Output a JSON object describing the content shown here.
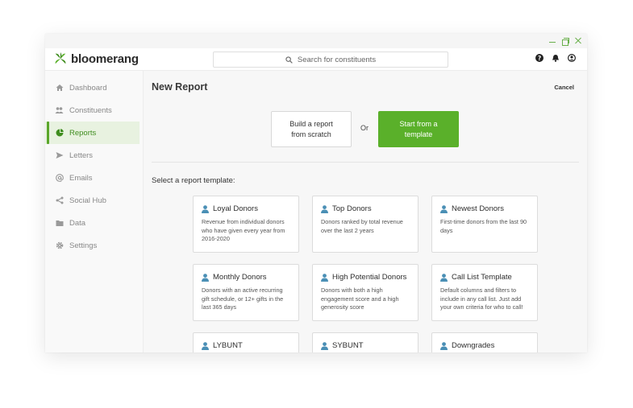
{
  "app": {
    "logo_text": "bloomerang",
    "brand_color": "#5ab02a"
  },
  "search": {
    "placeholder": "Search for constituents",
    "icon": "search-icon"
  },
  "top_icons": [
    "help-icon",
    "bell-icon",
    "user-icon"
  ],
  "sidebar": {
    "items": [
      {
        "label": "Dashboard",
        "icon": "home-icon",
        "active": false
      },
      {
        "label": "Constituents",
        "icon": "people-icon",
        "active": false
      },
      {
        "label": "Reports",
        "icon": "pie-chart-icon",
        "active": true
      },
      {
        "label": "Letters",
        "icon": "send-icon",
        "active": false
      },
      {
        "label": "Emails",
        "icon": "at-icon",
        "active": false
      },
      {
        "label": "Social Hub",
        "icon": "share-icon",
        "active": false
      },
      {
        "label": "Data",
        "icon": "folder-icon",
        "active": false
      },
      {
        "label": "Settings",
        "icon": "gear-icon",
        "active": false
      }
    ]
  },
  "main": {
    "title": "New Report",
    "cancel_label": "Cancel",
    "build_scratch_label": "Build a report from scratch",
    "or_label": "Or",
    "start_template_label": "Start from a template",
    "select_label": "Select a report template:",
    "templates": [
      {
        "title": "Loyal Donors",
        "desc": "Revenue from individual donors who have given every year from 2016-2020"
      },
      {
        "title": "Top Donors",
        "desc": "Donors ranked by total revenue over the last 2 years"
      },
      {
        "title": "Newest Donors",
        "desc": "First-time donors from the last 90 days"
      },
      {
        "title": "Monthly Donors",
        "desc": "Donors with an active recurring gift schedule, or 12+ gifts in the last 365 days"
      },
      {
        "title": "High Potential Donors",
        "desc": "Donors with both a high engagement score and a high generosity score"
      },
      {
        "title": "Call List Template",
        "desc": "Default columns and filters to include in any call list. Just add your own criteria for who to call!"
      },
      {
        "title": "LYBUNT",
        "desc": ""
      },
      {
        "title": "SYBUNT",
        "desc": ""
      },
      {
        "title": "Downgrades",
        "desc": ""
      }
    ]
  }
}
